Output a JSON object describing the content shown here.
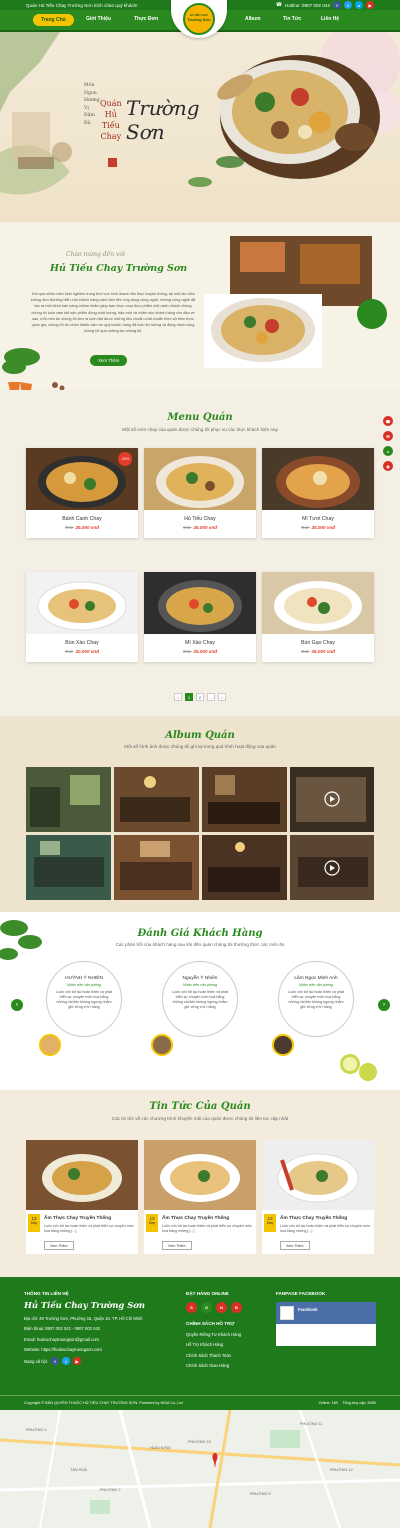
{
  "topbar": {
    "welcome": "Quán Hủ Tiếu Chay Trường Sơn kính chào quý khách!",
    "hotline": "Hotline: 0907 002 042"
  },
  "nav": {
    "items": [
      "Trang Chủ",
      "Giới Thiệu",
      "Thực Đơn",
      "Album",
      "Tin Tức",
      "Liên Hệ"
    ]
  },
  "logo": {
    "text": "Trường Sơn",
    "sub": "HỦ TIẾU CHAY"
  },
  "hero": {
    "vertical_lines": [
      "Món",
      "Ngon",
      "Hương",
      "Vị",
      "Đậm",
      "Đà"
    ],
    "title_lines": [
      "Quán",
      "Hủ",
      "Tiếu",
      "Chay"
    ],
    "calligraphy": "Trường Sơn"
  },
  "intro": {
    "script": "Chào mừng đến với",
    "title": "Hủ Tiếu Chay Trường Sơn",
    "body": "Trải qua nhiều năm kinh nghiệm trong thời vực kinh doanh ẩm thực truyền thống, tại một lần nắm không đơn thường hiểu của khách hàng cách làm tiến ứng dụng công nghệ, những công nghệ đã tạo ra một kênh bán hàng online nhằm giúp bạn chọn mua thực phẩm một cách nhanh chóng chúng tôi luôn cam kết sản phẩm đồng chất lượng, bảo mới và chăm sóc khách hàng chu đáo về sau, mỗi món ăn chúng tôi làm ra luôn đạt được những tiêu chuẩn chất chuẩn theo sở tiêm thực quốc gia, chúng tôi xin chân thành cảm ơn quý khách hàng đã luôn tin tưởng và đồng hành cùng chúng tôi qua những lần chúng tôi.",
    "button": "Xem Thêm"
  },
  "menu": {
    "title": "Menu Quán",
    "subtitle": "Một số món chay của quán được chúng tôi phục vụ các thực khách hiện nay",
    "old_label": "Giá:",
    "items": [
      {
        "name": "Bánh Canh Chay",
        "old": "Giá:",
        "price": "25.000 vnđ",
        "badge": "-20%"
      },
      {
        "name": "Hủ Tiếu Chay",
        "old": "Giá:",
        "price": "25.000 vnđ"
      },
      {
        "name": "Mì Tươi Chay",
        "old": "Giá:",
        "price": "25.000 vnđ"
      },
      {
        "name": "Bún Xào Chay",
        "old": "Giá:",
        "price": "20.000 vnđ"
      },
      {
        "name": "Mì Xào Chay",
        "old": "Giá:",
        "price": "25.000 vnđ"
      },
      {
        "name": "Bún Gạo Chay",
        "old": "Giá:",
        "price": "25.000 vnđ"
      }
    ],
    "pages": [
      "‹",
      "1",
      "2",
      "...",
      "›"
    ]
  },
  "album": {
    "title": "Album Quán",
    "subtitle": "Một số hình ảnh được chúng tôi ghi lại trong quá trình hoạt động của quán"
  },
  "reviews": {
    "title": "Đánh Giá Khách Hàng",
    "subtitle": "Các phản hồi của khách hàng sau khi đến quán chúng tôi thưởng thức các món ăn",
    "items": [
      {
        "name": "HUỲNH Ý NHIÊN",
        "role": "Nhân viên văn phòng",
        "text": "Luôn vốn tốt lạc hoàn thiện và phát triển sự chuyên môn hoá bằng những cải tiến không ngừng nhằm giữ vững vị trí hàng"
      },
      {
        "name": "Nguyễn Ý Nhiên",
        "role": "Nhân viên văn phòng",
        "text": "Luôn vốn tốt lạc hoàn thiện và phát triển sự chuyên môn hoá bằng những cải tiến không ngừng nhằm giữ vững vị trí hàng"
      },
      {
        "name": "Lâm Ngọc Minh Anh",
        "role": "Nhân viên văn phòng",
        "text": "Luôn vốn tốt lạc hoàn thiện và phát triển sự chuyên môn hoá bằng những cải tiến không ngừng nhằm giữ vững vị trí hàng"
      }
    ]
  },
  "news": {
    "title": "Tin Tức Của Quán",
    "subtitle": "Các tin tức về các chương trình khuyến mãi của quán được chúng tôi liên tục cập nhật",
    "items": [
      {
        "day": "13",
        "month": "May",
        "title": "Ẩm Thực Chay Truyền Thống",
        "text": "Luôn vốn tốt lạc hoàn thiện và phát triển sự chuyên môn hoá bằng những [...]",
        "button": "Xem Thêm"
      },
      {
        "day": "13",
        "month": "May",
        "title": "Ẩm Thực Chay Truyền Thống",
        "text": "Luôn vốn tốt lạc hoàn thiện và phát triển sự chuyên môn hoá bằng những [...]",
        "button": "Xem Thêm"
      },
      {
        "day": "13",
        "month": "May",
        "title": "Ẩm Thực Chay Truyền Thống",
        "text": "Luôn vốn tốt lạc hoàn thiện và phát triển sự chuyên môn hoá bằng những [...]",
        "button": "Xem Thêm"
      }
    ]
  },
  "footer": {
    "contact_heading": "THÔNG TIN LIÊN HỆ",
    "brand": "Hủ Tiếu Chay Trường Sơn",
    "address": "Địa chỉ: 49 Trường Sơn, Phường 15, Quận 10, TP. Hồ Chí Minh",
    "phone": "Điện thoại: 0907 002 042 - 0907 002 042",
    "email": "Email: hutieuchaytruongson@gmail.com",
    "website": "Website: https://hutieuchaytruongson.com",
    "social_label": "Mạng xã hội:",
    "order_heading": "ĐẶT HÀNG ONLINE",
    "policy_heading": "CHÍNH SÁCH HỖ TRỢ",
    "policies": [
      "Quyền Riêng Tư Khách Hàng",
      "Hỗ Trợ Khách Hàng",
      "Chính Sách Thanh Toán",
      "Chính Sách Giao Hàng"
    ],
    "fanpage_heading": "FANPAGE FACEBOOK",
    "fb_name": "Facebook",
    "copyright": "Copyright © BẢN QUYỀN THUỘC HỦ TIẾU CHAY TRƯỜNG SƠN. Powered by NINA Co.,Ltd",
    "online": "Online: 180",
    "visits": "Tổng truy cập: 5080"
  },
  "map": {
    "labels": [
      "PHƯỜNG 4",
      "TÂN HOÀ",
      "PHƯỜNG 11",
      "PHƯỜNG 15",
      "PHƯỜNG 9",
      "HOÀ HƯNG",
      "PHƯỜNG 12",
      "PHƯỜNG 7"
    ]
  },
  "colors": {
    "green": "#2a8a1f",
    "dark_green": "#1e7a1a",
    "yellow": "#f5c400",
    "red": "#e23b2a",
    "cream": "#f7f2e6"
  }
}
